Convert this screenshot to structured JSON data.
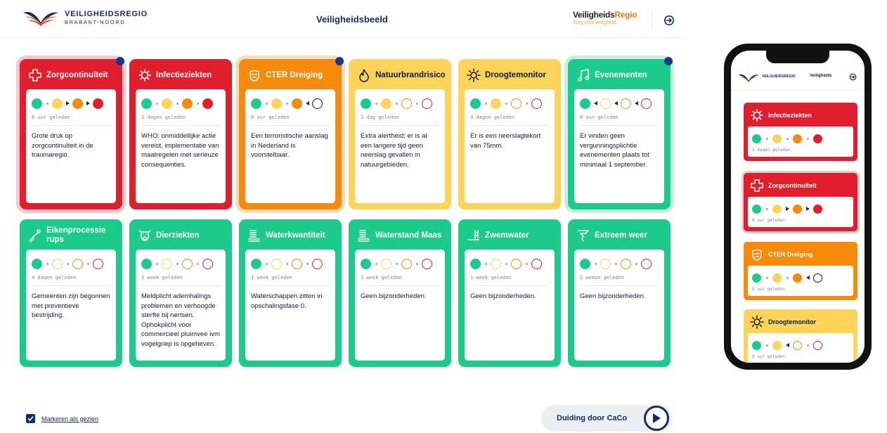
{
  "header": {
    "logo_line1": "VEILIGHEIDSREGIO",
    "logo_line2": "BRABANT-NOORD",
    "title": "Veiligheidsbeeld",
    "brand_main_a": "Veiligheids",
    "brand_main_b": "Regio",
    "brand_sub": "Zorg voor veiligheid"
  },
  "colors": {
    "red": "#e01e2e",
    "orange": "#f58a0d",
    "yellow": "#fdd35a",
    "green": "#1ccb8c",
    "navy": "#0d2d6b"
  },
  "cards": [
    {
      "title": "Zorgcontinuïteit",
      "icon": "medical-cross-icon",
      "color": "red",
      "lights": [
        "green",
        "yellow",
        "orange",
        "red"
      ],
      "separators": [
        "dot",
        "arrow-right",
        "arrow-right"
      ],
      "active": 3,
      "timestamp": "8 uur geleden",
      "description": "Grote druk op zorgcontinuïteit in de traumaregio.",
      "badge": true,
      "halo": true
    },
    {
      "title": "Infectieziekten",
      "icon": "virus-icon",
      "color": "red",
      "lights": [
        "green",
        "yellow",
        "orange",
        "red"
      ],
      "separators": [
        "dot",
        "dot",
        "dot"
      ],
      "active": 3,
      "timestamp": "3 dagen geleden",
      "description": "WHO: onmiddellijke actie vereist, implementatie van maatregelen met serieuze consequenties.",
      "badge": false,
      "halo": false
    },
    {
      "title": "CTER Dreiging",
      "icon": "mask-icon",
      "color": "orange",
      "lights": [
        "green",
        "yellow",
        "orange",
        "outline-black"
      ],
      "separators": [
        "dot",
        "dot",
        "arrow-left-dot"
      ],
      "active": 2,
      "timestamp": "8 uur geleden",
      "description": "Een terroristische aanslag in Nederland is voorstelbaar.",
      "badge": true,
      "halo": true
    },
    {
      "title": "Natuurbrandrisico",
      "icon": "flame-icon",
      "color": "yellow",
      "lights": [
        "green",
        "yellow",
        "outline-orange",
        "outline-red"
      ],
      "separators": [
        "dot",
        "dot",
        "dot"
      ],
      "active": 1,
      "timestamp": "1 dag geleden",
      "description": "Extra alertheid; er is al een langere tijd geen neerslag gevallen in natuurgebieden.",
      "badge": false,
      "halo": false
    },
    {
      "title": "Droogtemonitor",
      "icon": "sun-icon",
      "color": "yellow",
      "lights": [
        "green",
        "yellow",
        "outline-orange",
        "outline-red"
      ],
      "separators": [
        "dot",
        "dot",
        "dot"
      ],
      "active": 1,
      "timestamp": "3 dagen geleden",
      "description": "Er is een neerslagtekort van 75mm.",
      "badge": false,
      "halo": false
    },
    {
      "title": "Evenementen",
      "icon": "music-icon",
      "color": "green",
      "lights": [
        "green",
        "outline-yellow",
        "outline-orange",
        "outline-red"
      ],
      "separators": [
        "arrow-left",
        "arrow-left",
        "arrow-left"
      ],
      "active": 0,
      "timestamp": "8 uur geleden",
      "description": "Er vinden geen vergunningsplichtie evenementen plaats tot minimaal 1 september.",
      "badge": true,
      "halo": true
    },
    {
      "title": "Eikenprocessie rups",
      "icon": "caterpillar-icon",
      "color": "green",
      "lights": [
        "green",
        "outline-yellow",
        "outline-orange",
        "outline-red"
      ],
      "separators": [
        "dot",
        "dot",
        "dot"
      ],
      "active": 0,
      "timestamp": "4 dagen geleden",
      "description": "Gemeenten zijn begonnen met preventieve bestrijding.",
      "badge": false,
      "halo": false
    },
    {
      "title": "Dierziekten",
      "icon": "cow-icon",
      "color": "green",
      "lights": [
        "green",
        "outline-yellow",
        "outline-orange",
        "outline-red"
      ],
      "separators": [
        "dot",
        "dot",
        "dot"
      ],
      "active": 0,
      "timestamp": "1 week geleden",
      "description": "Meldplicht ademhalings problemen en verhoogde sterfte bij nertsen. Ophokplicht voor commercieel pluimvee ivm vogelgriep is opgeheven.",
      "badge": false,
      "halo": false
    },
    {
      "title": "Waterkwantiteit",
      "icon": "water-level-icon",
      "color": "green",
      "lights": [
        "green",
        "outline-yellow",
        "outline-orange",
        "outline-red"
      ],
      "separators": [
        "dot",
        "dot",
        "dot"
      ],
      "active": 0,
      "timestamp": "1 week geleden",
      "description": "Waterschappen zitten in opschalingsfase 0.",
      "badge": false,
      "halo": false
    },
    {
      "title": "Waterstand Maas",
      "icon": "water-level-icon",
      "color": "green",
      "lights": [
        "green",
        "outline-yellow",
        "outline-orange",
        "outline-red"
      ],
      "separators": [
        "dot",
        "dot",
        "dot"
      ],
      "active": 0,
      "timestamp": "1 week geleden",
      "description": "Geen bijzonderheden.",
      "badge": false,
      "halo": false
    },
    {
      "title": "Zwemwater",
      "icon": "swimming-icon",
      "color": "green",
      "lights": [
        "green",
        "outline-yellow",
        "outline-orange",
        "outline-red"
      ],
      "separators": [
        "dot",
        "dot",
        "dot"
      ],
      "active": 0,
      "timestamp": "1 week geleden",
      "description": "Geen bijzonderheden.",
      "badge": false,
      "halo": false
    },
    {
      "title": "Extreem weer",
      "icon": "tornado-icon",
      "color": "green",
      "lights": [
        "green",
        "outline-yellow",
        "outline-orange",
        "outline-red"
      ],
      "separators": [
        "dot",
        "dot",
        "dot"
      ],
      "active": 0,
      "timestamp": "2 weken geleden",
      "description": "Geen bijzonderheden.",
      "badge": false,
      "halo": false
    }
  ],
  "footer": {
    "mark_seen": "Markeren als gezien",
    "caco_button": "Duiding door CaCo"
  },
  "phone": {
    "cards": [
      {
        "title": "Infectieziekten",
        "icon": "virus-icon",
        "color": "red",
        "lights": [
          "green",
          "yellow",
          "orange",
          "red"
        ],
        "separators": [
          "dot",
          "dot",
          "dot"
        ],
        "timestamp": "3 dagen geleden",
        "halo": false
      },
      {
        "title": "Zorgcontinuïteit",
        "icon": "medical-cross-icon",
        "color": "red",
        "lights": [
          "green",
          "yellow",
          "orange",
          "red"
        ],
        "separators": [
          "dot",
          "arrow-right",
          "arrow-right"
        ],
        "timestamp": "8 uur geleden",
        "halo": true
      },
      {
        "title": "CTER Dreiging",
        "icon": "mask-icon",
        "color": "orange",
        "lights": [
          "green",
          "yellow",
          "orange",
          "outline-black"
        ],
        "separators": [
          "dot",
          "dot",
          "arrow-left"
        ],
        "timestamp": "8 uur geleden",
        "halo": false
      },
      {
        "title": "Droogtemonitor",
        "icon": "sun-icon",
        "color": "yellow",
        "lights": [
          "green",
          "yellow",
          "outline-orange",
          "outline-red"
        ],
        "separators": [
          "dot",
          "arrow-left",
          "dot"
        ],
        "timestamp": "8 uur geleden",
        "halo": false
      }
    ]
  }
}
